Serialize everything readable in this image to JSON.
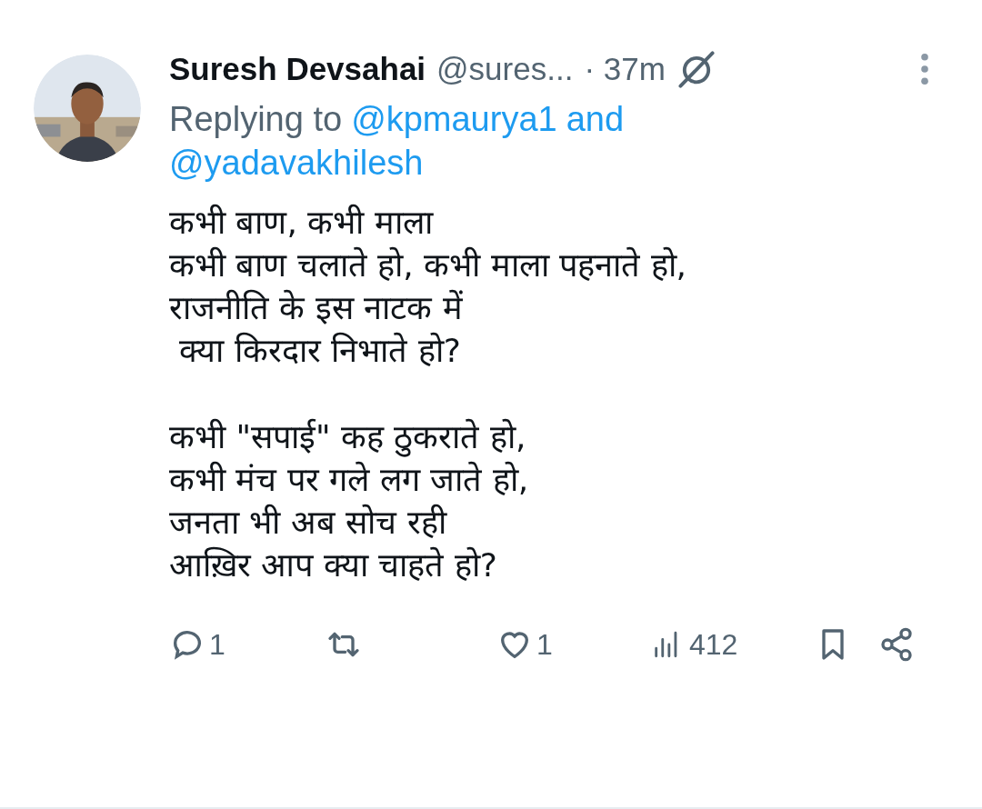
{
  "post": {
    "author": {
      "name": "Suresh Devsahai",
      "handle": "@sures...",
      "time": "· 37m"
    },
    "reply": {
      "prefix": "Replying to",
      "mentions": [
        "@kpmaurya1",
        "@yadavakhilesh"
      ],
      "joiner": "and"
    },
    "stanzas": [
      [
        "कभी बाण, कभी माला",
        "कभी बाण चलाते हो, कभी माला पहनाते हो,",
        "राजनीति के इस नाटक में",
        " क्या किरदार निभाते हो?"
      ],
      [
        "कभी \"सपाई\" कह ठुकराते हो,",
        "कभी मंच पर गले लग जाते हो,",
        "जनता भी अब सोच रही",
        "आख़िर आप क्या चाहते हो?"
      ]
    ],
    "actions": {
      "replies": "1",
      "likes": "1",
      "liked": false,
      "views": "412",
      "bookmarked": false
    }
  }
}
